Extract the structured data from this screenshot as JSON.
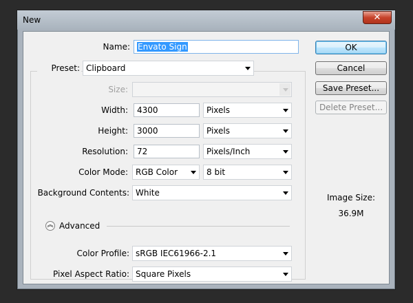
{
  "window": {
    "title": "New",
    "close_glyph": "✕"
  },
  "form": {
    "name_label": "Name:",
    "name_value": "Envato Sign",
    "preset_label": "Preset:",
    "preset_value": "Clipboard",
    "size_label": "Size:",
    "size_value": "",
    "width_label": "Width:",
    "width_value": "4300",
    "width_unit": "Pixels",
    "height_label": "Height:",
    "height_value": "3000",
    "height_unit": "Pixels",
    "resolution_label": "Resolution:",
    "resolution_value": "72",
    "resolution_unit": "Pixels/Inch",
    "color_mode_label": "Color Mode:",
    "color_mode_value": "RGB Color",
    "bit_depth_value": "8 bit",
    "background_label": "Background Contents:",
    "background_value": "White",
    "advanced_label": "Advanced",
    "color_profile_label": "Color Profile:",
    "color_profile_value": "sRGB IEC61966-2.1",
    "pixel_aspect_label": "Pixel Aspect Ratio:",
    "pixel_aspect_value": "Square Pixels"
  },
  "buttons": {
    "ok": "OK",
    "cancel": "Cancel",
    "save_preset": "Save Preset...",
    "delete_preset": "Delete Preset..."
  },
  "image_size": {
    "label": "Image Size:",
    "value": "36.9M"
  },
  "icons": {
    "dropdown": "chevron-down-icon",
    "advanced_toggle": "double-chevron-up-icon",
    "close": "close-icon"
  },
  "colors": {
    "selection": "#3399ff",
    "default_button": "#bee6fd",
    "close_button": "#c7432b"
  }
}
